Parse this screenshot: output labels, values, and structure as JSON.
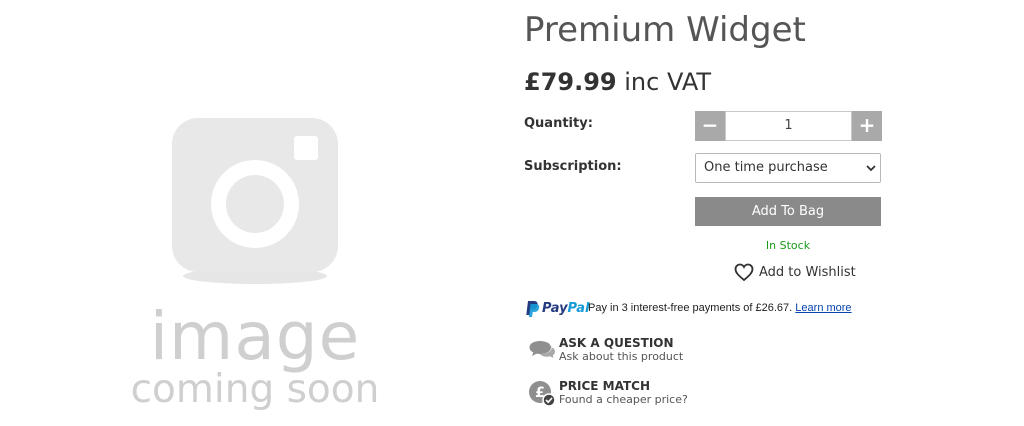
{
  "image_placeholder": {
    "line1": "image",
    "line2": "coming soon",
    "icon": "camera-icon"
  },
  "product": {
    "title": "Premium Widget",
    "price": "£79.99",
    "price_suffix": "inc VAT"
  },
  "quantity": {
    "label": "Quantity:",
    "value": "1",
    "minus": "−",
    "plus": "+"
  },
  "subscription": {
    "label": "Subscription:",
    "selected": "One time purchase"
  },
  "actions": {
    "add_to_bag": "Add To Bag",
    "stock_status": "In Stock",
    "wishlist": "Add to Wishlist"
  },
  "paypal": {
    "brand_pay": "Pay",
    "brand_pal": "Pal",
    "message": "Pay in 3 interest-free payments of £26.67.",
    "link": "Learn more"
  },
  "features": {
    "ask_title": "ASK A QUESTION",
    "ask_sub": "Ask about this product",
    "match_title": "PRICE MATCH",
    "match_sub": "Found a cheaper price?"
  },
  "colors": {
    "in_stock": "#1a9a1a",
    "button": "#8a8a8a",
    "stepper": "#a9a9a9",
    "paypal_dark": "#253b80",
    "paypal_light": "#179bd7"
  }
}
